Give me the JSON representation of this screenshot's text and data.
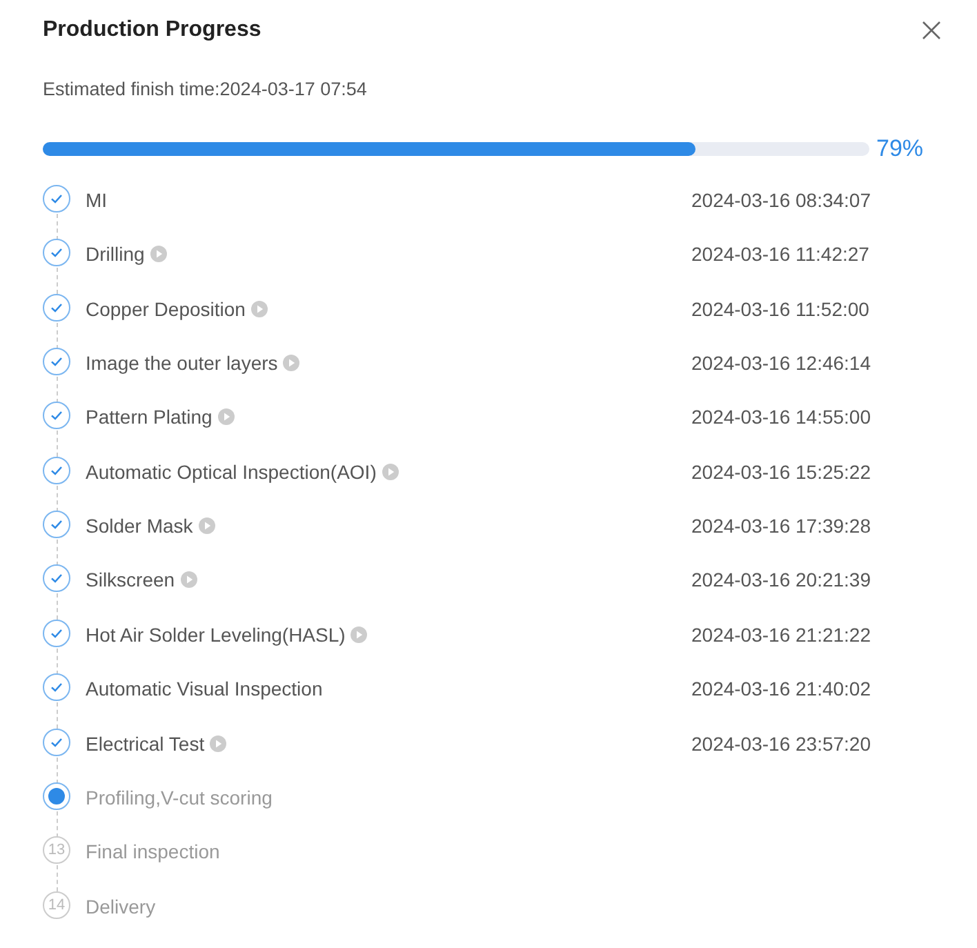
{
  "dialog": {
    "title": "Production Progress",
    "subtitle": "Estimated finish time:2024-03-17 07:54"
  },
  "progress": {
    "level": 0.79,
    "reading": "79%"
  },
  "steps": [
    {
      "kind": "done",
      "label": "MI",
      "play": false,
      "time": "2024-03-16 08:34:07"
    },
    {
      "kind": "done",
      "label": "Drilling",
      "play": true,
      "time": "2024-03-16 11:42:27"
    },
    {
      "kind": "done",
      "label": "Copper Deposition",
      "play": true,
      "time": "2024-03-16 11:52:00"
    },
    {
      "kind": "done",
      "label": "Image the outer layers",
      "play": true,
      "time": "2024-03-16 12:46:14"
    },
    {
      "kind": "done",
      "label": "Pattern Plating",
      "play": true,
      "time": "2024-03-16 14:55:00"
    },
    {
      "kind": "done",
      "label": "Automatic Optical Inspection(AOI)",
      "play": true,
      "time": "2024-03-16 15:25:22"
    },
    {
      "kind": "done",
      "label": "Solder Mask",
      "play": true,
      "time": "2024-03-16 17:39:28"
    },
    {
      "kind": "done",
      "label": "Silkscreen",
      "play": true,
      "time": "2024-03-16 20:21:39"
    },
    {
      "kind": "done",
      "label": "Hot Air Solder Leveling(HASL)",
      "play": true,
      "time": "2024-03-16 21:21:22"
    },
    {
      "kind": "done",
      "label": "Automatic Visual Inspection",
      "play": false,
      "time": "2024-03-16 21:40:02"
    },
    {
      "kind": "done",
      "label": "Electrical Test",
      "play": true,
      "time": "2024-03-16 23:57:20"
    },
    {
      "kind": "current",
      "label": "Profiling,V-cut scoring",
      "play": false
    },
    {
      "kind": "pending",
      "number": "13",
      "label": "Final inspection",
      "play": false
    },
    {
      "kind": "pending",
      "number": "14",
      "label": "Delivery",
      "play": false
    }
  ]
}
